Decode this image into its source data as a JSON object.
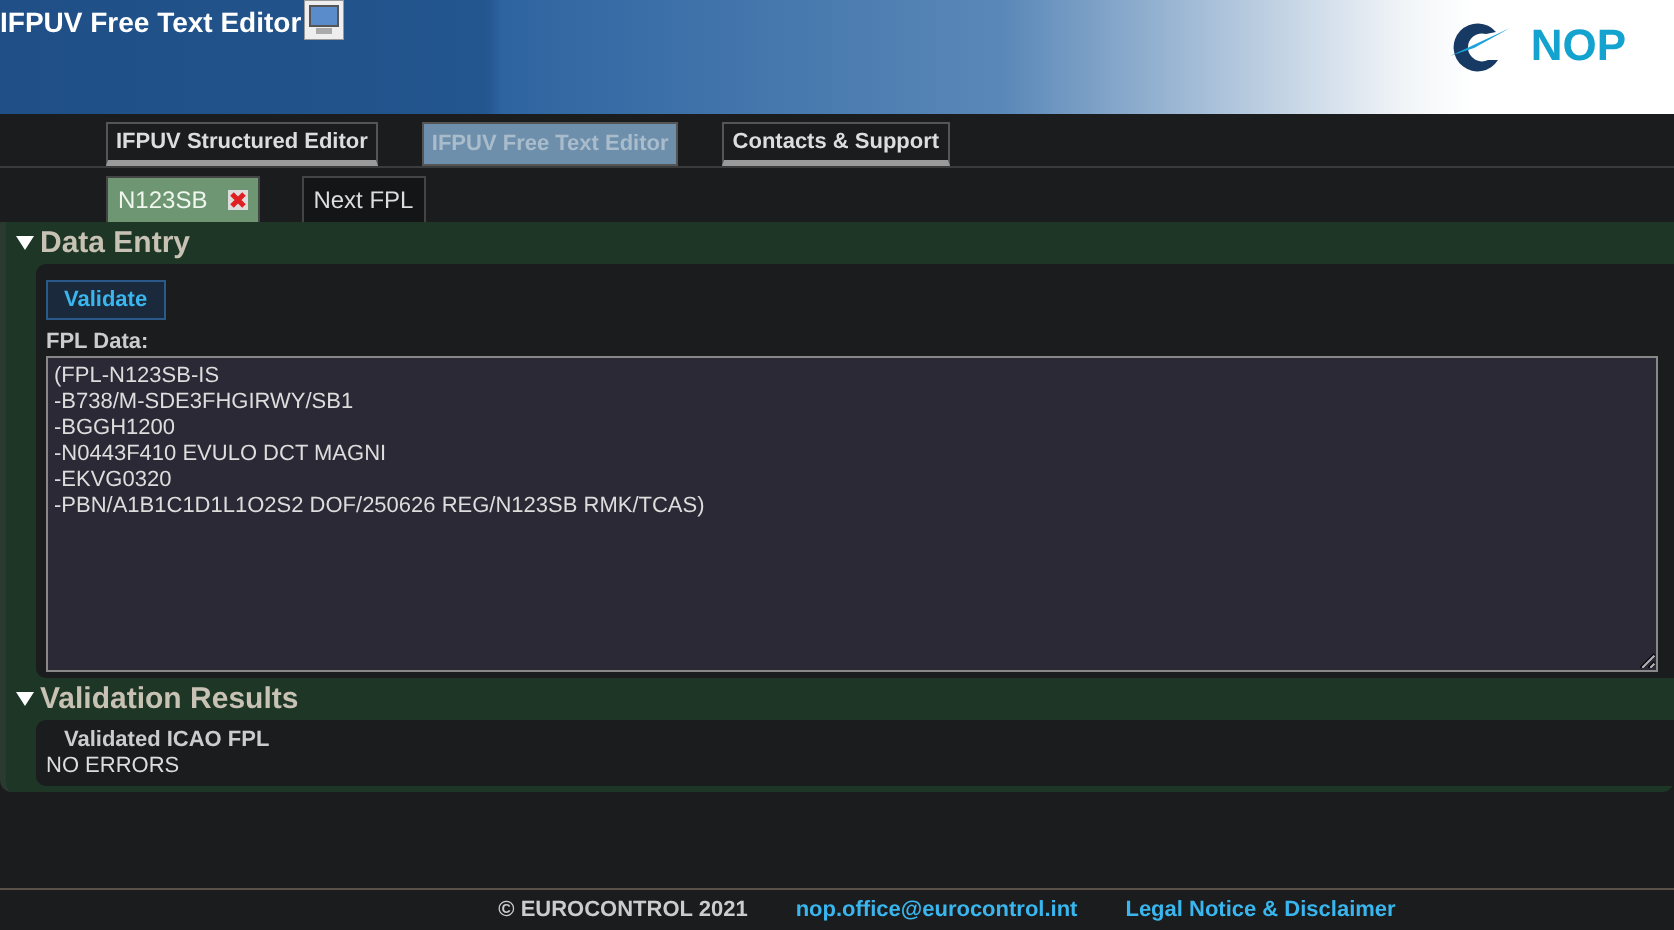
{
  "header": {
    "title": "IFPUV Free Text Editor",
    "logo_text": "NOP"
  },
  "nav": [
    {
      "label": "IFPUV Structured Editor",
      "selected": false
    },
    {
      "label": "IFPUV Free Text Editor",
      "selected": true
    },
    {
      "label": "Contacts & Support",
      "selected": false
    }
  ],
  "flight_tabs": [
    {
      "label": "N123SB",
      "selected": true,
      "closable": true
    },
    {
      "label": "Next FPL",
      "selected": false,
      "closable": false
    }
  ],
  "data_entry": {
    "title": "Data Entry",
    "expanded": true,
    "button": "Validate",
    "field_label": "FPL Data:",
    "value": "(FPL-N123SB-IS\n-B738/M-SDE3FHGIRWY/SB1\n-BGGH1200\n-N0443F410 EVULO DCT MAGNI\n-EKVG0320\n-PBN/A1B1C1D1L1O2S2 DOF/250626 REG/N123SB RMK/TCAS)"
  },
  "validation_results": {
    "title": "Validation Results",
    "expanded": true,
    "heading": "Validated ICAO FPL",
    "message": "NO ERRORS"
  },
  "footer": {
    "copyright": "© EUROCONTROL 2021",
    "email": "nop.office@eurocontrol.int",
    "legal": "Legal Notice & Disclaimer"
  }
}
